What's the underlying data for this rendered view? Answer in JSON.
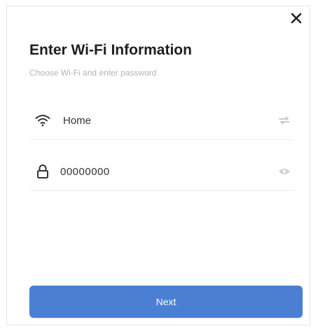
{
  "dialog": {
    "title": "Enter Wi-Fi Information",
    "subtitle": "Choose Wi-Fi and enter password",
    "close_icon": "close-icon"
  },
  "wifi_field": {
    "icon": "wifi-icon",
    "value": "Home",
    "action_icon": "switch-network-icon"
  },
  "password_field": {
    "icon": "lock-icon",
    "value": "00000000",
    "action_icon": "eye-icon"
  },
  "actions": {
    "next_label": "Next"
  },
  "colors": {
    "primary": "#4a7fd4",
    "title": "#1e1e1e",
    "subtitle": "#b4b4b4",
    "divider": "#ecf0f4"
  }
}
